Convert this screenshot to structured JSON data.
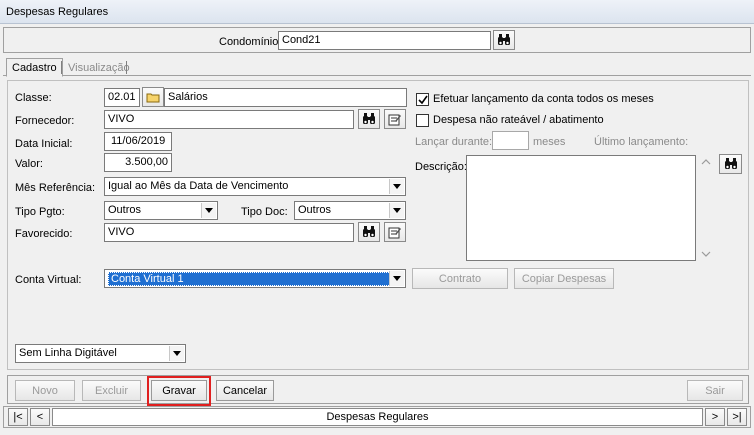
{
  "window": {
    "title": "Despesas Regulares"
  },
  "header": {
    "condominio_label": "Condomínio:",
    "condominio_value": "Cond21"
  },
  "tabs": [
    {
      "label": "Cadastro"
    },
    {
      "label": "Visualização"
    }
  ],
  "form": {
    "classe_label": "Classe:",
    "classe_code": "02.01",
    "classe_name": "Salários",
    "fornecedor_label": "Fornecedor:",
    "fornecedor_value": "VIVO",
    "data_inicial_label": "Data Inicial:",
    "data_inicial_value": "11/06/2019",
    "valor_label": "Valor:",
    "valor_value": "3.500,00",
    "mes_ref_label": "Mês Referência:",
    "mes_ref_value": "Igual ao Mês da Data de Vencimento",
    "tipo_pgto_label": "Tipo Pgto:",
    "tipo_pgto_value": "Outros",
    "tipo_doc_label": "Tipo Doc:",
    "tipo_doc_value": "Outros",
    "favorecido_label": "Favorecido:",
    "favorecido_value": "VIVO",
    "conta_virtual_label": "Conta Virtual:",
    "conta_virtual_value": "Conta Virtual 1",
    "linha_digitavel_value": "Sem Linha Digitável"
  },
  "options": {
    "efetuar_label": "Efetuar lançamento da conta todos os meses",
    "efetuar_checked": true,
    "nao_rateavel_label": "Despesa não rateável / abatimento",
    "nao_rateavel_checked": false,
    "lancar_durante_label": "Lançar durante:",
    "meses_label": "meses",
    "ultimo_lancamento_label": "Último lançamento:",
    "descricao_label": "Descrição:"
  },
  "buttons": {
    "contrato": "Contrato",
    "copiar_despesas": "Copiar Despesas",
    "novo": "Novo",
    "excluir": "Excluir",
    "gravar": "Gravar",
    "cancelar": "Cancelar",
    "sair": "Sair"
  },
  "navigator": {
    "first": "|<",
    "prev": "<",
    "caption": "Despesas Regulares",
    "next": ">",
    "last": ">|"
  },
  "colors": {
    "selection": "#1f6fd1",
    "focus_outline": "#e02020"
  }
}
